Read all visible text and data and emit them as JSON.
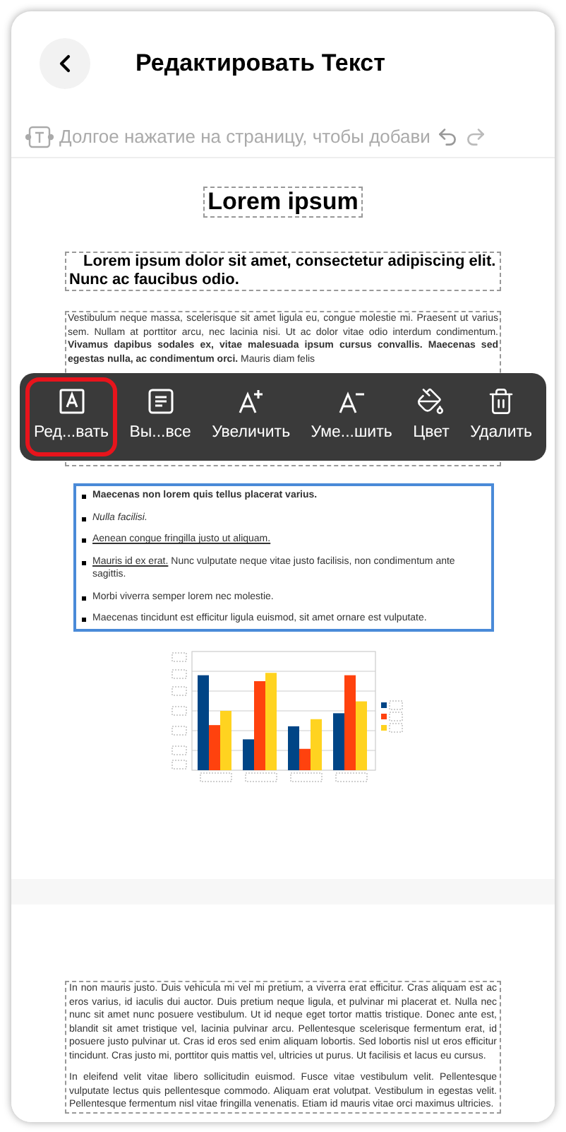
{
  "header": {
    "title": "Редактировать Текст"
  },
  "hint": {
    "text": "Долгое нажатие на страницу, чтобы добави"
  },
  "document": {
    "title": "Lorem ipsum",
    "subtitle": "Lorem ipsum dolor sit amet, consectetur adipiscing elit. Nunc ac faucibus odio.",
    "paragraph": "Vestibulum neque massa, scelerisque sit amet ligula eu, congue molestie mi. Praesent ut varius sem. Nullam at porttitor arcu, nec lacinia nisi. Ut ac dolor vitae odio interdum condimentum. **Vivamus dapibus sodales ex, vitae malesuada ipsum cursus convallis. Maecenas sed egestas nulla, ac condimentum orci.** Mauris diam felis",
    "list": {
      "selected": true,
      "items": [
        {
          "kind": "bold",
          "text": "Maecenas non lorem quis tellus placerat varius."
        },
        {
          "kind": "italic",
          "text": "Nulla facilisi."
        },
        {
          "kind": "underline",
          "text": "Aenean congue fringilla justo ut aliquam."
        },
        {
          "kind": "underline_lead",
          "lead": "Mauris id ex erat.",
          "text": "Nunc vulputate neque vitae justo facilisis, non condimentum ante sagittis."
        },
        {
          "kind": "plain",
          "text": "Morbi viverra semper lorem nec molestie."
        },
        {
          "kind": "plain",
          "text": "Maecenas tincidunt est efficitur ligula euismod, sit amet ornare est vulputate."
        }
      ]
    },
    "page2": [
      "In non mauris justo. Duis vehicula mi vel mi pretium, a viverra erat efficitur. Cras aliquam est ac eros varius, id iaculis dui auctor. Duis pretium neque ligula, et pulvinar mi placerat et. Nulla nec nunc sit amet nunc posuere vestibulum. Ut id neque eget tortor mattis tristique. Donec ante est, blandit sit amet tristique vel, lacinia pulvinar arcu. Pellentesque scelerisque fermentum erat, id posuere justo pulvinar ut. Cras id eros sed enim aliquam lobortis. Sed lobortis nisl ut eros efficitur tincidunt. Cras justo mi, porttitor quis mattis vel, ultricies ut purus. Ut facilisis et lacus eu cursus.",
      "In eleifend velit vitae libero sollicitudin euismod. Fusce vitae vestibulum velit. Pellentesque vulputate lectus quis pellentesque commodo. Aliquam erat volutpat. Vestibulum in egestas velit. Pellentesque fermentum nisl vitae fringilla venenatis. Etiam id mauris vitae orci maximus ultricies."
    ]
  },
  "toolbar": [
    {
      "kind": "edit",
      "label": "Ред...вать",
      "selected": true
    },
    {
      "kind": "select_all",
      "label": "Вы...все",
      "selected": false
    },
    {
      "kind": "increase",
      "label": "Увеличить",
      "selected": false
    },
    {
      "kind": "decrease",
      "label": "Уме...шить",
      "selected": false
    },
    {
      "kind": "color",
      "label": "Цвет",
      "selected": false
    },
    {
      "kind": "delete",
      "label": "Удалить",
      "selected": false
    }
  ]
}
